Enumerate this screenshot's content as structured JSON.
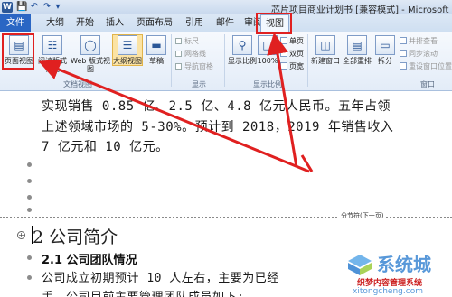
{
  "window": {
    "title": "芯片项目商业计划书 [兼容模式] - Microsoft Word",
    "logo": "W"
  },
  "quick_access": {
    "save_icon": "save-icon",
    "undo_icon": "undo-icon",
    "redo_icon": "redo-icon"
  },
  "tabs": [
    "文件",
    "大纲",
    "开始",
    "插入",
    "页面布局",
    "引用",
    "邮件",
    "审阅",
    "视图"
  ],
  "ribbon": {
    "views": [
      "页面视图",
      "阅读版式视图",
      "Web 版式视图",
      "大纲视图",
      "草稿"
    ],
    "views_group_label": "文档视图",
    "show": [
      "标尺",
      "网格线",
      "导航窗格"
    ],
    "show_group_label": "显示",
    "zoom": [
      "显示比例",
      "100%",
      "单页",
      "双页",
      "页宽"
    ],
    "zoom_group_label": "显示比例",
    "window": [
      "新建窗口",
      "全部重排",
      "拆分",
      "并排查看",
      "同步滚动",
      "重设窗口位置"
    ],
    "window_group_label": "窗口"
  },
  "document": {
    "lines": [
      "实现销售 0.85 亿、2.5 亿、4.8 亿元人民币。五年占领",
      "上述领域市场的 5-30%。预计到 2018，2019 年销售收入",
      "7 亿元和 10 亿元。"
    ],
    "section_break": "分节符(下一页)",
    "heading": "2 公司简介",
    "subheading": "2.1 公司团队情况",
    "body_lines": [
      "公司成立初期预计 10 人左右，主要为已经",
      "手。公司目前主要管理团队成员如下:"
    ]
  },
  "watermark": {
    "text": "系统城",
    "url": "xitongcheng.com",
    "tagline": "织梦内容管理系统"
  },
  "colors": {
    "file_tab": "#2a66c4",
    "highlight": "#e02020",
    "accent": "#2b5797"
  }
}
